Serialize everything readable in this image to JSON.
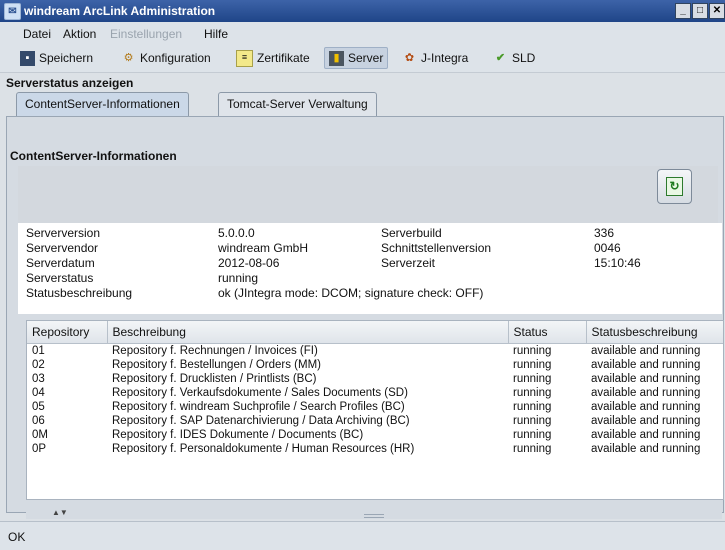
{
  "window": {
    "title": "windream ArcLink Administration"
  },
  "menu": [
    {
      "label": "Datei",
      "enabled": true
    },
    {
      "label": "Aktion",
      "enabled": true
    },
    {
      "label": "Einstellungen",
      "enabled": false
    },
    {
      "label": "Hilfe",
      "enabled": true
    }
  ],
  "toolbar": [
    {
      "label": "Speichern",
      "icon": "floppy-disk-icon"
    },
    {
      "label": "Konfiguration",
      "icon": "gear-icon"
    },
    {
      "label": "Zertifikate",
      "icon": "certificate-icon"
    },
    {
      "label": "Server",
      "icon": "server-icon",
      "active": true
    },
    {
      "label": "J-Integra",
      "icon": "j-integra-icon"
    },
    {
      "label": "SLD",
      "icon": "checkmark-icon"
    }
  ],
  "section_label": "Serverstatus anzeigen",
  "tabs": [
    {
      "label": "ContentServer-Informationen",
      "selected": true
    },
    {
      "label": "Tomcat-Server Verwaltung",
      "selected": false
    }
  ],
  "panel_title": "ContentServer-Informationen",
  "info": {
    "serverversion_label": "Serverversion",
    "serverversion_value": "5.0.0.0",
    "serverbuild_label": "Serverbuild",
    "serverbuild_value": "336",
    "servervendor_label": "Servervendor",
    "servervendor_value": "windream GmbH",
    "schnittstelle_label": "Schnittstellenversion",
    "schnittstelle_value": "0046",
    "serverdatum_label": "Serverdatum",
    "serverdatum_value": "2012-08-06",
    "serverzeit_label": "Serverzeit",
    "serverzeit_value": "15:10:46",
    "serverstatus_label": "Serverstatus",
    "serverstatus_value": "running",
    "statusbeschreibung_label": "Statusbeschreibung",
    "statusbeschreibung_value": "ok (JIntegra mode: DCOM; signature check: OFF)"
  },
  "table": {
    "columns": [
      "Repository",
      "Beschreibung",
      "Status",
      "Statusbeschreibung"
    ],
    "rows": [
      [
        "01",
        "Repository f. Rechnungen / Invoices (FI)",
        "running",
        "available and running"
      ],
      [
        "02",
        "Repository f. Bestellungen / Orders (MM)",
        "running",
        "available and running"
      ],
      [
        "03",
        "Repository f. Drucklisten / Printlists (BC)",
        "running",
        "available and running"
      ],
      [
        "04",
        "Repository f. Verkaufsdokumente / Sales Documents (SD)",
        "running",
        "available and running"
      ],
      [
        "05",
        "Repository f. windream Suchprofile / Search Profiles (BC)",
        "running",
        "available and running"
      ],
      [
        "06",
        "Repository f. SAP Datenarchivierung / Data Archiving (BC)",
        "running",
        "available and running"
      ],
      [
        "0M",
        "Repository f. IDES Dokumente / Documents (BC)",
        "running",
        "available and running"
      ],
      [
        "0P",
        "Repository f. Personaldokumente / Human Resources (HR)",
        "running",
        "available and running"
      ]
    ]
  },
  "status_bar": "OK",
  "colors": {
    "titlebar": "#1f4588",
    "accent": "#cbd8e8",
    "refresh_icon": "#1f7a1f"
  }
}
